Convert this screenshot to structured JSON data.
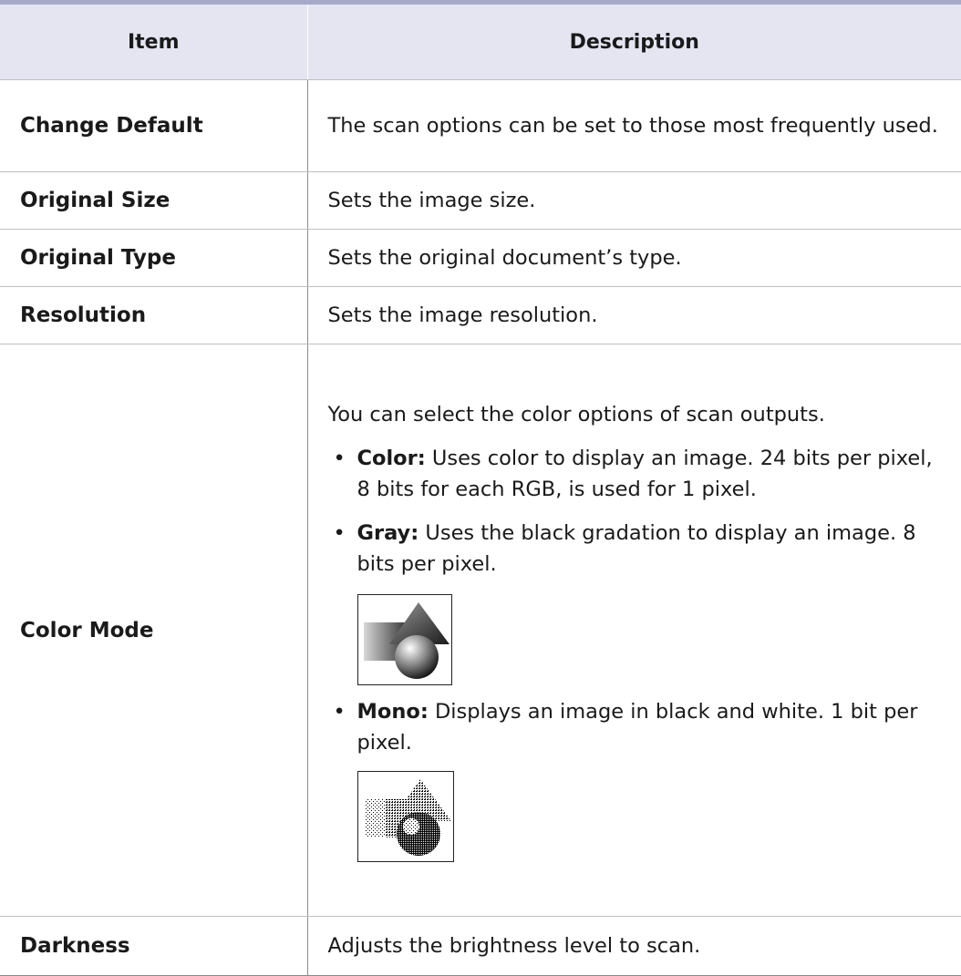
{
  "headers": {
    "item": "Item",
    "description": "Description"
  },
  "rows": [
    {
      "item": "Change Default",
      "description": "The scan options can be set to those most frequently used."
    },
    {
      "item": "Original Size",
      "description": "Sets the image size."
    },
    {
      "item": "Original Type",
      "description": "Sets the original document’s type."
    },
    {
      "item": "Resolution",
      "description": "Sets the image resolution."
    },
    {
      "item": "Color Mode",
      "intro": "You can select the color options of scan outputs.",
      "options": [
        {
          "bullet": "•",
          "label": "Color:",
          "text": " Uses color to display an image. 24 bits per pixel, 8 bits for each RGB, is used for 1 pixel."
        },
        {
          "bullet": "•",
          "label": "Gray:",
          "text": " Uses the black gradation to display an image. 8 bits per pixel."
        },
        {
          "bullet": "•",
          "label": "Mono:",
          "text": "  Displays an image in black and white. 1 bit per pixel."
        }
      ],
      "images": {
        "gray": "gray-shapes-icon",
        "mono": "mono-shapes-icon"
      }
    },
    {
      "item": "Darkness",
      "description": "Adjusts the brightness level to scan."
    }
  ],
  "colors": {
    "header_bg": "#e4e5f1",
    "top_rule": "#a7a9c9",
    "divider": "#8a8a8a"
  }
}
